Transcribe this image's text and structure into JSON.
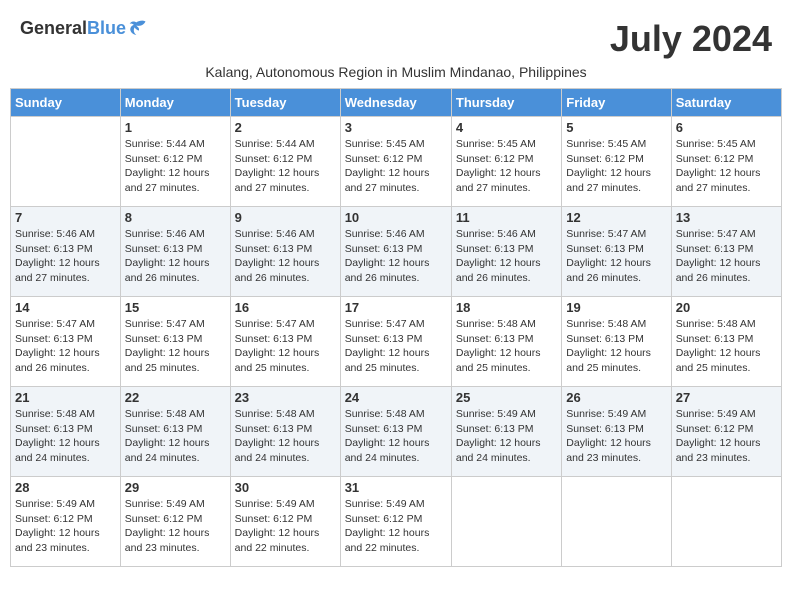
{
  "header": {
    "logo_general": "General",
    "logo_blue": "Blue",
    "month_title": "July 2024",
    "subtitle": "Kalang, Autonomous Region in Muslim Mindanao, Philippines"
  },
  "days_of_week": [
    "Sunday",
    "Monday",
    "Tuesday",
    "Wednesday",
    "Thursday",
    "Friday",
    "Saturday"
  ],
  "weeks": [
    [
      {
        "day": "",
        "sunrise": "",
        "sunset": "",
        "daylight": ""
      },
      {
        "day": "1",
        "sunrise": "Sunrise: 5:44 AM",
        "sunset": "Sunset: 6:12 PM",
        "daylight": "Daylight: 12 hours and 27 minutes."
      },
      {
        "day": "2",
        "sunrise": "Sunrise: 5:44 AM",
        "sunset": "Sunset: 6:12 PM",
        "daylight": "Daylight: 12 hours and 27 minutes."
      },
      {
        "day": "3",
        "sunrise": "Sunrise: 5:45 AM",
        "sunset": "Sunset: 6:12 PM",
        "daylight": "Daylight: 12 hours and 27 minutes."
      },
      {
        "day": "4",
        "sunrise": "Sunrise: 5:45 AM",
        "sunset": "Sunset: 6:12 PM",
        "daylight": "Daylight: 12 hours and 27 minutes."
      },
      {
        "day": "5",
        "sunrise": "Sunrise: 5:45 AM",
        "sunset": "Sunset: 6:12 PM",
        "daylight": "Daylight: 12 hours and 27 minutes."
      },
      {
        "day": "6",
        "sunrise": "Sunrise: 5:45 AM",
        "sunset": "Sunset: 6:12 PM",
        "daylight": "Daylight: 12 hours and 27 minutes."
      }
    ],
    [
      {
        "day": "7",
        "sunrise": "Sunrise: 5:46 AM",
        "sunset": "Sunset: 6:13 PM",
        "daylight": "Daylight: 12 hours and 27 minutes."
      },
      {
        "day": "8",
        "sunrise": "Sunrise: 5:46 AM",
        "sunset": "Sunset: 6:13 PM",
        "daylight": "Daylight: 12 hours and 26 minutes."
      },
      {
        "day": "9",
        "sunrise": "Sunrise: 5:46 AM",
        "sunset": "Sunset: 6:13 PM",
        "daylight": "Daylight: 12 hours and 26 minutes."
      },
      {
        "day": "10",
        "sunrise": "Sunrise: 5:46 AM",
        "sunset": "Sunset: 6:13 PM",
        "daylight": "Daylight: 12 hours and 26 minutes."
      },
      {
        "day": "11",
        "sunrise": "Sunrise: 5:46 AM",
        "sunset": "Sunset: 6:13 PM",
        "daylight": "Daylight: 12 hours and 26 minutes."
      },
      {
        "day": "12",
        "sunrise": "Sunrise: 5:47 AM",
        "sunset": "Sunset: 6:13 PM",
        "daylight": "Daylight: 12 hours and 26 minutes."
      },
      {
        "day": "13",
        "sunrise": "Sunrise: 5:47 AM",
        "sunset": "Sunset: 6:13 PM",
        "daylight": "Daylight: 12 hours and 26 minutes."
      }
    ],
    [
      {
        "day": "14",
        "sunrise": "Sunrise: 5:47 AM",
        "sunset": "Sunset: 6:13 PM",
        "daylight": "Daylight: 12 hours and 26 minutes."
      },
      {
        "day": "15",
        "sunrise": "Sunrise: 5:47 AM",
        "sunset": "Sunset: 6:13 PM",
        "daylight": "Daylight: 12 hours and 25 minutes."
      },
      {
        "day": "16",
        "sunrise": "Sunrise: 5:47 AM",
        "sunset": "Sunset: 6:13 PM",
        "daylight": "Daylight: 12 hours and 25 minutes."
      },
      {
        "day": "17",
        "sunrise": "Sunrise: 5:47 AM",
        "sunset": "Sunset: 6:13 PM",
        "daylight": "Daylight: 12 hours and 25 minutes."
      },
      {
        "day": "18",
        "sunrise": "Sunrise: 5:48 AM",
        "sunset": "Sunset: 6:13 PM",
        "daylight": "Daylight: 12 hours and 25 minutes."
      },
      {
        "day": "19",
        "sunrise": "Sunrise: 5:48 AM",
        "sunset": "Sunset: 6:13 PM",
        "daylight": "Daylight: 12 hours and 25 minutes."
      },
      {
        "day": "20",
        "sunrise": "Sunrise: 5:48 AM",
        "sunset": "Sunset: 6:13 PM",
        "daylight": "Daylight: 12 hours and 25 minutes."
      }
    ],
    [
      {
        "day": "21",
        "sunrise": "Sunrise: 5:48 AM",
        "sunset": "Sunset: 6:13 PM",
        "daylight": "Daylight: 12 hours and 24 minutes."
      },
      {
        "day": "22",
        "sunrise": "Sunrise: 5:48 AM",
        "sunset": "Sunset: 6:13 PM",
        "daylight": "Daylight: 12 hours and 24 minutes."
      },
      {
        "day": "23",
        "sunrise": "Sunrise: 5:48 AM",
        "sunset": "Sunset: 6:13 PM",
        "daylight": "Daylight: 12 hours and 24 minutes."
      },
      {
        "day": "24",
        "sunrise": "Sunrise: 5:48 AM",
        "sunset": "Sunset: 6:13 PM",
        "daylight": "Daylight: 12 hours and 24 minutes."
      },
      {
        "day": "25",
        "sunrise": "Sunrise: 5:49 AM",
        "sunset": "Sunset: 6:13 PM",
        "daylight": "Daylight: 12 hours and 24 minutes."
      },
      {
        "day": "26",
        "sunrise": "Sunrise: 5:49 AM",
        "sunset": "Sunset: 6:13 PM",
        "daylight": "Daylight: 12 hours and 23 minutes."
      },
      {
        "day": "27",
        "sunrise": "Sunrise: 5:49 AM",
        "sunset": "Sunset: 6:12 PM",
        "daylight": "Daylight: 12 hours and 23 minutes."
      }
    ],
    [
      {
        "day": "28",
        "sunrise": "Sunrise: 5:49 AM",
        "sunset": "Sunset: 6:12 PM",
        "daylight": "Daylight: 12 hours and 23 minutes."
      },
      {
        "day": "29",
        "sunrise": "Sunrise: 5:49 AM",
        "sunset": "Sunset: 6:12 PM",
        "daylight": "Daylight: 12 hours and 23 minutes."
      },
      {
        "day": "30",
        "sunrise": "Sunrise: 5:49 AM",
        "sunset": "Sunset: 6:12 PM",
        "daylight": "Daylight: 12 hours and 22 minutes."
      },
      {
        "day": "31",
        "sunrise": "Sunrise: 5:49 AM",
        "sunset": "Sunset: 6:12 PM",
        "daylight": "Daylight: 12 hours and 22 minutes."
      },
      {
        "day": "",
        "sunrise": "",
        "sunset": "",
        "daylight": ""
      },
      {
        "day": "",
        "sunrise": "",
        "sunset": "",
        "daylight": ""
      },
      {
        "day": "",
        "sunrise": "",
        "sunset": "",
        "daylight": ""
      }
    ]
  ]
}
